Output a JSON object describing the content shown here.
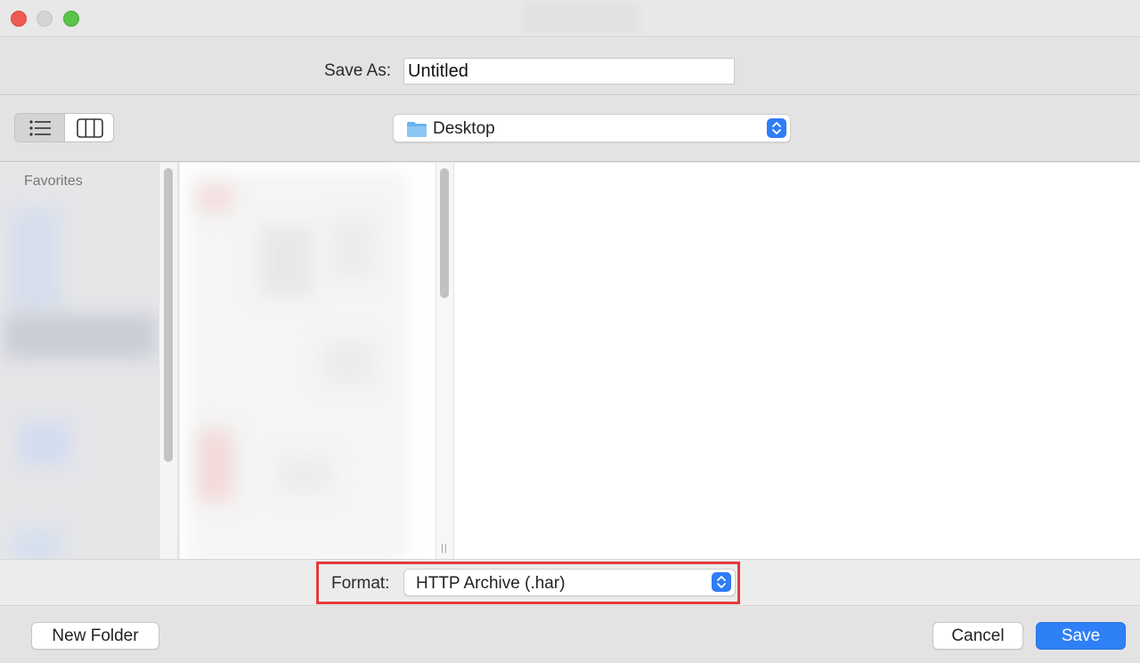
{
  "window": {
    "controls": [
      "close",
      "minimize",
      "zoom"
    ]
  },
  "save_as": {
    "label": "Save As:",
    "value": "Untitled"
  },
  "toolbar": {
    "view_modes": [
      {
        "icon": "list-view-icon",
        "selected": false
      },
      {
        "icon": "column-view-icon",
        "selected": true
      }
    ],
    "location": {
      "icon": "folder-icon",
      "label": "Desktop"
    }
  },
  "sidebar": {
    "header": "Favorites"
  },
  "format": {
    "label": "Format:",
    "value": "HTTP Archive (.har)",
    "highlight_color": "#e43b3b"
  },
  "buttons": {
    "new_folder": "New Folder",
    "cancel": "Cancel",
    "save": "Save"
  },
  "colors": {
    "accent": "#2f80f6",
    "close": "#ee5b52",
    "zoom": "#5bc24a"
  }
}
